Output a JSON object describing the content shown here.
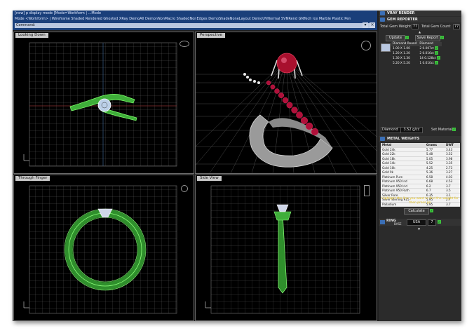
{
  "command": {
    "line1": "[new] p display mode [Mode=Workform | ...Mode",
    "line2": "Mode <Workform> | Wireframe  Shaded  Rendered  Ghosted  XRay  DemoAll  DemonNonMacro  ShadedNonEdges  DemoShadeNoneLayout  DemoUVNormal  SVNRend  GNTech  Ice  Marble  Plastic  Pen",
    "line3": "Command:"
  },
  "viewports": {
    "top_left": "Looking Down",
    "top_right": "Perspective",
    "bottom_left": "Through Finger",
    "bottom_right": "Side View"
  },
  "right_panel": {
    "vray_header": "VRAY RENDER",
    "gem_header": "GEM REPORTER",
    "total_weight_label": "Total Gem Weight",
    "total_weight_value": "77",
    "total_count_label": "Total Gem Count",
    "total_count_value": "77",
    "update_button": "Update",
    "save_report_button": "Save Report",
    "gem_table": {
      "headers": [
        "Diamond Round",
        "Diamond"
      ],
      "rows": [
        [
          "1.00 X 1.00",
          "2",
          "0.007ct"
        ],
        [
          "1.20 X 1.20",
          "2",
          "0.016ct"
        ],
        [
          "1.30 X 1.30",
          "14",
          "0.128ct"
        ],
        [
          "5.20 X 5.20",
          "1",
          "0.610ct"
        ]
      ]
    },
    "gem_select": "Diamond",
    "gem_density": "3.52 g/cc",
    "set_material_button": "Set Material",
    "metal_header": "METAL WEIGHTS",
    "metal_table": {
      "headers": [
        "Metal",
        "Grams",
        "DWT"
      ],
      "rows": [
        [
          "Gold 24k",
          "5.77",
          "3.43"
        ],
        [
          "Gold 22k",
          "5.48",
          "3.52"
        ],
        [
          "Gold 18k",
          "5.05",
          "3.98"
        ],
        [
          "Gold 14k",
          "5.52",
          "3.35"
        ],
        [
          "Gold 10k",
          "4.25",
          "2.73"
        ],
        [
          "Gold 9k",
          "5.36",
          "3.27"
        ],
        [
          "Platinum Pure",
          "6.58",
          "4.03"
        ],
        [
          "Platinum 950 Ind",
          "6.68",
          "4.53"
        ],
        [
          "Platinum 950 Irid",
          "6.2",
          "3.7"
        ],
        [
          "Platinum 950 Ruth",
          "6.7",
          "3.5"
        ],
        [
          "Silver Pure",
          "6.35",
          "3.1"
        ],
        [
          "Silver Sterling 925",
          "5.95",
          "2.7"
        ],
        [
          "Palladium",
          "5.95",
          "3.7"
        ]
      ]
    },
    "hint_text": "Highlight the line you want to find the weight for then press go",
    "calculate_button": "Calculate",
    "ring_label": "RING",
    "ring_sub": "BASE",
    "ring_select": "USA",
    "ring_size": "7"
  }
}
